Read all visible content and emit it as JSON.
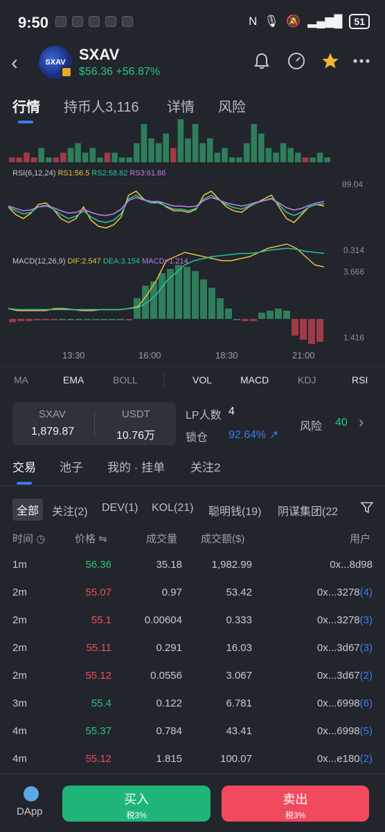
{
  "status_bar": {
    "time": "9:50",
    "battery": "51"
  },
  "header": {
    "token_name": "SXAV",
    "price": "$56.36",
    "change": "+56.87%",
    "icons": [
      "back-icon",
      "bell-icon",
      "gauge-icon",
      "star-icon",
      "more-icon"
    ]
  },
  "tabs": [
    {
      "label": "行情"
    },
    {
      "label": "持币人3,116"
    },
    {
      "label": "详情"
    },
    {
      "label": "风险"
    }
  ],
  "rsi": {
    "label": "RSI(6,12,24)",
    "rs1": "RS1:56.5",
    "rs2": "RS2:58.82",
    "rs3": "RS3:61.86",
    "axis_top": "89.04",
    "axis_bottom": "0.314"
  },
  "macd": {
    "label": "MACD(12,26,9)",
    "dif": "DIF:2.547",
    "dea": "DEA:3.154",
    "macd": "MACD:-1.214",
    "axis_top": "3.666",
    "axis_bottom": "1.416"
  },
  "time_ticks": [
    "13:30",
    "16:00",
    "18:30",
    "21:00"
  ],
  "indicators": {
    "main": [
      "MA",
      "EMA",
      "BOLL"
    ],
    "sub": [
      "VOL",
      "MACD",
      "KDJ",
      "RSI"
    ]
  },
  "pool": {
    "token_label": "SXAV",
    "token_amount": "1,879.87",
    "quote_label": "USDT",
    "quote_amount": "10.76万",
    "lp_label": "LP人数",
    "lp_count": "4",
    "lock_label": "锁仓",
    "lock_pct": "92.64%",
    "risk_label": "风险",
    "risk_value": "40"
  },
  "section_tabs": [
    "交易",
    "池子",
    "我的 · 挂单",
    "关注2"
  ],
  "filters": [
    "全部",
    "关注(2)",
    "DEV(1)",
    "KOL(21)",
    "聪明钱(19)",
    "阴谋集团(22"
  ],
  "table": {
    "headers": {
      "time": "时间",
      "price": "价格",
      "qty": "成交量",
      "amount": "成交额($)",
      "user": "用户"
    },
    "rows": [
      {
        "time": "1m",
        "price": "56.36",
        "dir": "up",
        "qty": "35.18",
        "amount": "1,982.99",
        "user": "0x...8d98",
        "count": ""
      },
      {
        "time": "2m",
        "price": "55.07",
        "dir": "down",
        "qty": "0.97",
        "amount": "53.42",
        "user": "0x...3278",
        "count": "(4)"
      },
      {
        "time": "2m",
        "price": "55.1",
        "dir": "down",
        "qty": "0.00604",
        "amount": "0.333",
        "user": "0x...3278",
        "count": "(3)"
      },
      {
        "time": "2m",
        "price": "55.11",
        "dir": "down",
        "qty": "0.291",
        "amount": "16.03",
        "user": "0x...3d67",
        "count": "(3)"
      },
      {
        "time": "2m",
        "price": "55.12",
        "dir": "down",
        "qty": "0.0556",
        "amount": "3.067",
        "user": "0x...3d67",
        "count": "(2)"
      },
      {
        "time": "3m",
        "price": "55.4",
        "dir": "up",
        "qty": "0.122",
        "amount": "6.781",
        "user": "0x...6998",
        "count": "(6)"
      },
      {
        "time": "4m",
        "price": "55.37",
        "dir": "up",
        "qty": "0.784",
        "amount": "43.41",
        "user": "0x...6998",
        "count": "(5)"
      },
      {
        "time": "4m",
        "price": "55.12",
        "dir": "down",
        "qty": "1.815",
        "amount": "100.07",
        "user": "0x...e180",
        "count": "(2)"
      }
    ]
  },
  "bottom": {
    "dapp_label": "DApp",
    "buy_label": "买入",
    "buy_tax": "税3%",
    "sell_label": "卖出",
    "sell_tax": "税3%"
  },
  "colors": {
    "up": "#2ec27e",
    "down": "#ef4b5d",
    "accent": "#3a7cf0",
    "rsi1": "#e8c23a",
    "rsi2": "#2ec2a0",
    "rsi3": "#c27ae8"
  },
  "chart_data": [
    {
      "type": "bar",
      "title": "VOL",
      "values": [
        1,
        1,
        2,
        1,
        3,
        1,
        1,
        2,
        3,
        4,
        2,
        3,
        1,
        2,
        2,
        1,
        1,
        4,
        8,
        5,
        4,
        6,
        3,
        9,
        5,
        8,
        4,
        5,
        2,
        3,
        1,
        1,
        4,
        8,
        6,
        3,
        2,
        4,
        3,
        2,
        1,
        1,
        2,
        1
      ],
      "colors_dir": [
        "d",
        "d",
        "d",
        "d",
        "u",
        "u",
        "d",
        "d",
        "u",
        "u",
        "u",
        "u",
        "u",
        "d",
        "u",
        "u",
        "u",
        "u",
        "u",
        "u",
        "u",
        "u",
        "d",
        "u",
        "u",
        "u",
        "u",
        "u",
        "u",
        "u",
        "u",
        "u",
        "u",
        "u",
        "u",
        "u",
        "u",
        "u",
        "u",
        "u",
        "d",
        "u",
        "u",
        "u"
      ]
    },
    {
      "type": "line",
      "title": "RSI(6,12,24)",
      "ylim": [
        0.314,
        89.04
      ],
      "series": [
        {
          "name": "RS1",
          "values": [
            55,
            45,
            40,
            47,
            58,
            60,
            52,
            40,
            35,
            40,
            55,
            38,
            30,
            28,
            32,
            42,
            70,
            75,
            65,
            60,
            62,
            55,
            50,
            50,
            48,
            52,
            70,
            75,
            65,
            55,
            50,
            48,
            55,
            60,
            65,
            70,
            55,
            40,
            35,
            45,
            55,
            58,
            56
          ]
        },
        {
          "name": "RS2",
          "values": [
            55,
            50,
            46,
            48,
            55,
            57,
            52,
            45,
            40,
            43,
            50,
            42,
            37,
            35,
            38,
            46,
            65,
            70,
            64,
            60,
            60,
            56,
            52,
            52,
            50,
            53,
            65,
            70,
            64,
            58,
            54,
            52,
            56,
            60,
            63,
            66,
            58,
            48,
            44,
            48,
            55,
            58,
            59
          ]
        },
        {
          "name": "RS3",
          "values": [
            56,
            53,
            50,
            51,
            55,
            56,
            54,
            50,
            47,
            48,
            52,
            48,
            45,
            44,
            46,
            52,
            63,
            67,
            64,
            62,
            62,
            59,
            56,
            56,
            55,
            56,
            63,
            67,
            64,
            60,
            58,
            56,
            58,
            61,
            63,
            65,
            60,
            54,
            51,
            53,
            57,
            60,
            62
          ]
        }
      ]
    },
    {
      "type": "bar",
      "title": "MACD(12,26,9)",
      "ylim": [
        1.416,
        3.666
      ],
      "series": [
        {
          "name": "DIF",
          "values": [
            0.5,
            0.4,
            0.4,
            0.4,
            0.4,
            0.5,
            0.5,
            0.45,
            0.4,
            0.4,
            0.45,
            0.45,
            0.45,
            0.5,
            0.6,
            1.2,
            1.9,
            2.8,
            3.0,
            3.2,
            3.1,
            3.0,
            2.9,
            2.8,
            2.8,
            2.9,
            3.0,
            3.2,
            3.4,
            3.5,
            3.6,
            3.4,
            3.0,
            2.6,
            2.5
          ]
        },
        {
          "name": "DEA",
          "values": [
            0.5,
            0.45,
            0.45,
            0.45,
            0.45,
            0.45,
            0.45,
            0.45,
            0.45,
            0.45,
            0.45,
            0.45,
            0.45,
            0.5,
            0.55,
            0.8,
            1.2,
            1.8,
            2.2,
            2.6,
            2.8,
            2.9,
            3.0,
            3.05,
            3.1,
            3.15,
            3.15,
            3.2,
            3.3,
            3.35,
            3.4,
            3.35,
            3.25,
            3.2,
            3.15
          ]
        },
        {
          "name": "MACD",
          "values": [
            -0.15,
            -0.1,
            -0.1,
            -0.05,
            -0.05,
            -0.05,
            0,
            0,
            0,
            0,
            0,
            0,
            0,
            0,
            -0.05,
            1.0,
            1.6,
            1.8,
            2.2,
            2.4,
            2.6,
            2.5,
            2.3,
            1.9,
            1.5,
            1.0,
            0.5,
            0,
            -0.1,
            -0.1,
            0.3,
            0.4,
            0.5,
            0.4,
            -0.8,
            -1.0,
            -1.2,
            -1.1
          ]
        }
      ]
    }
  ]
}
